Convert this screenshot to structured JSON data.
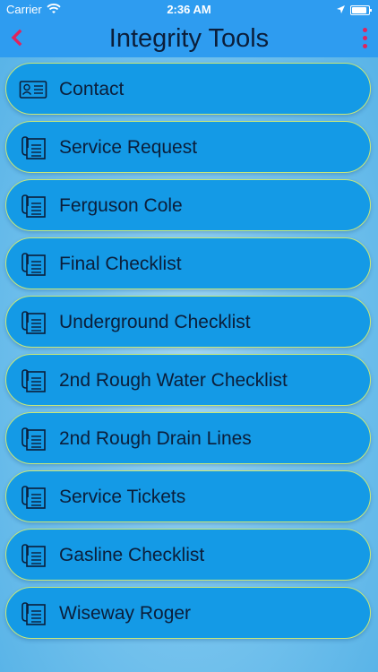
{
  "status_bar": {
    "carrier": "Carrier",
    "time": "2:36 AM"
  },
  "nav": {
    "title": "Integrity Tools",
    "back_icon": "chevron-left-icon",
    "menu_icon": "more-vertical-icon",
    "accent_color": "#e0245e"
  },
  "items": [
    {
      "label": "Contact",
      "icon": "contact-card-icon"
    },
    {
      "label": "Service Request",
      "icon": "clipboard-document-icon"
    },
    {
      "label": "Ferguson Cole",
      "icon": "clipboard-document-icon"
    },
    {
      "label": "Final Checklist",
      "icon": "clipboard-document-icon"
    },
    {
      "label": "Underground Checklist",
      "icon": "clipboard-document-icon"
    },
    {
      "label": "2nd Rough Water Checklist",
      "icon": "clipboard-document-icon"
    },
    {
      "label": "2nd Rough Drain Lines",
      "icon": "clipboard-document-icon"
    },
    {
      "label": "Service Tickets",
      "icon": "clipboard-document-icon"
    },
    {
      "label": "Gasline Checklist",
      "icon": "clipboard-document-icon"
    },
    {
      "label": "Wiseway Roger",
      "icon": "clipboard-document-icon"
    }
  ]
}
